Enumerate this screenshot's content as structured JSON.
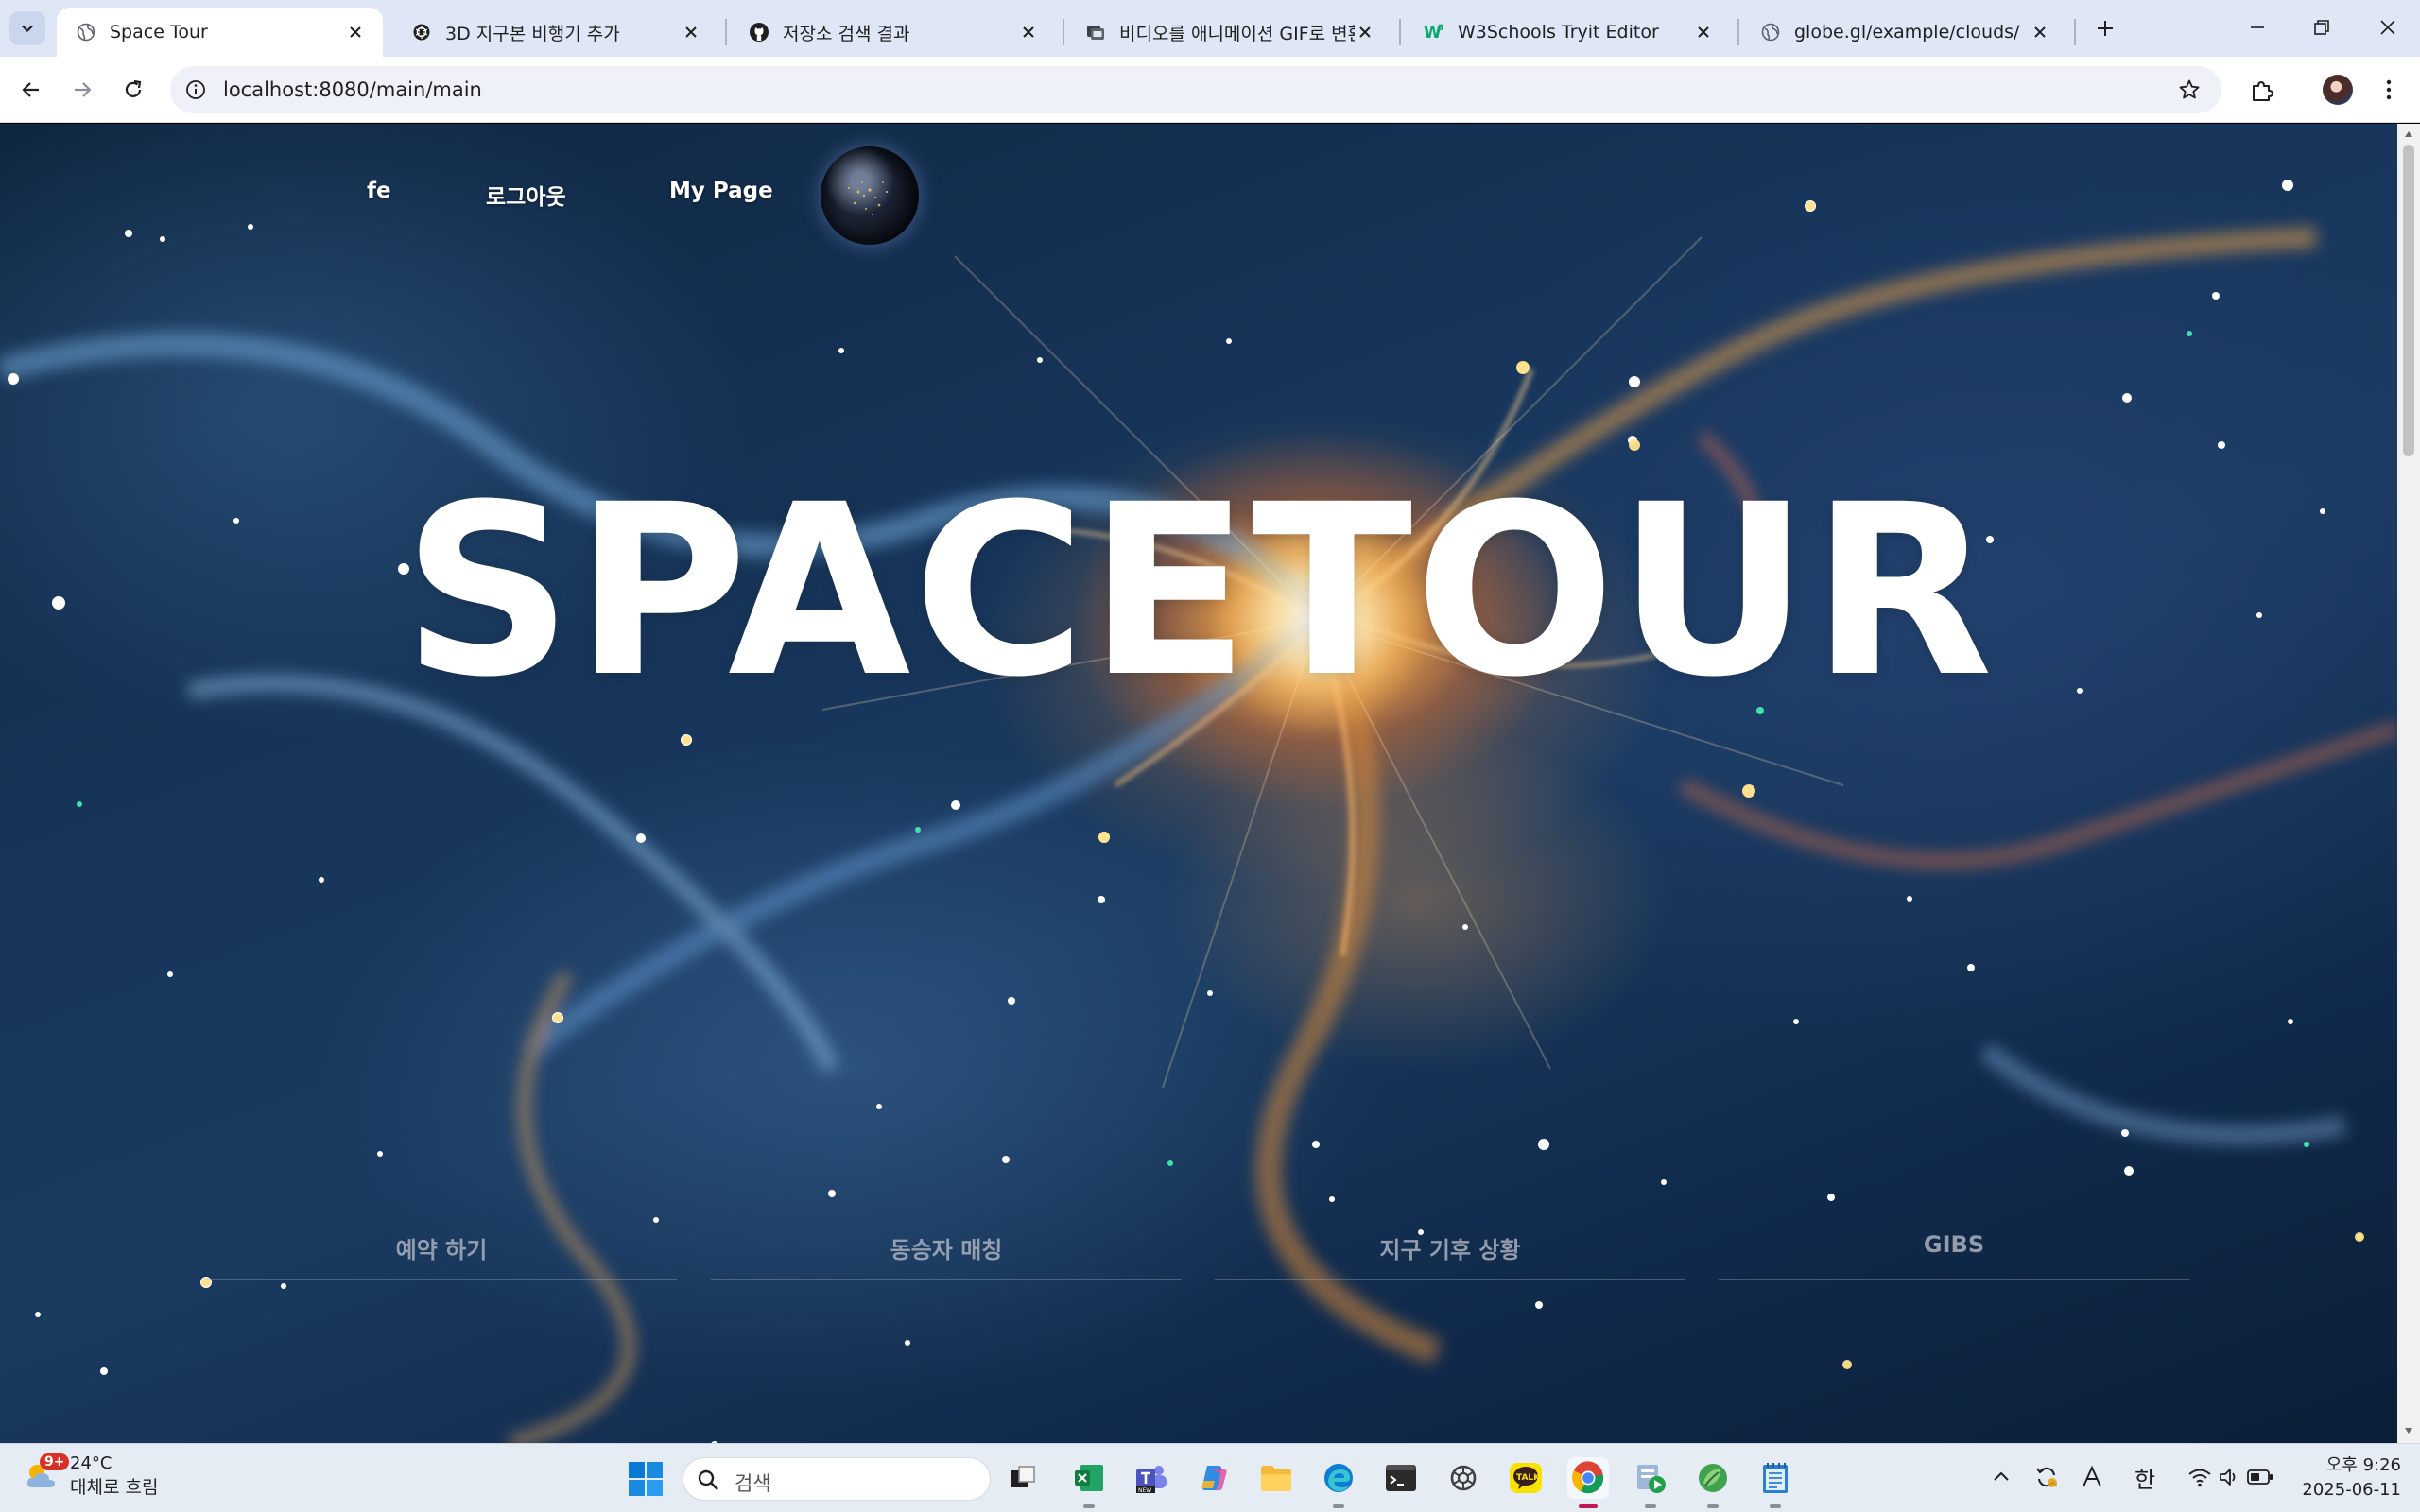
{
  "browser": {
    "tabs": [
      {
        "title": "Space Tour",
        "icon": "globe-icon",
        "active": true
      },
      {
        "title": "3D 지구본 비행기 추가",
        "icon": "openai-icon",
        "active": false
      },
      {
        "title": "저장소 검색 결과",
        "icon": "github-icon",
        "active": false
      },
      {
        "title": "비디오를 애니메이션 GIF로 변환",
        "icon": "converter-icon",
        "active": false
      },
      {
        "title": "W3Schools Tryit Editor",
        "icon": "w3schools-icon",
        "active": false
      },
      {
        "title": "globe.gl/example/clouds/",
        "icon": "globe-icon",
        "active": false
      }
    ],
    "url": "localhost:8080/main/main"
  },
  "site": {
    "nav": {
      "user": "fe",
      "logout": "로그아웃",
      "mypage": "My Page"
    },
    "hero_title": "SPACETOUR",
    "menu": [
      {
        "label": "예약 하기"
      },
      {
        "label": "동승자 매칭"
      },
      {
        "label": "지구 기후 상황"
      },
      {
        "label": "GIBS"
      }
    ]
  },
  "taskbar": {
    "weather": {
      "badge": "9+",
      "temp": "24°C",
      "condition": "대체로 흐림"
    },
    "search_placeholder": "검색",
    "ime": "한",
    "time": "오후 9:26",
    "date": "2025-06-11"
  },
  "colors": {
    "tabstrip": "#dfe7f6",
    "page_bg": "#17355a",
    "hero_text": "#ffffff",
    "menu_text": "#aaafbc"
  }
}
